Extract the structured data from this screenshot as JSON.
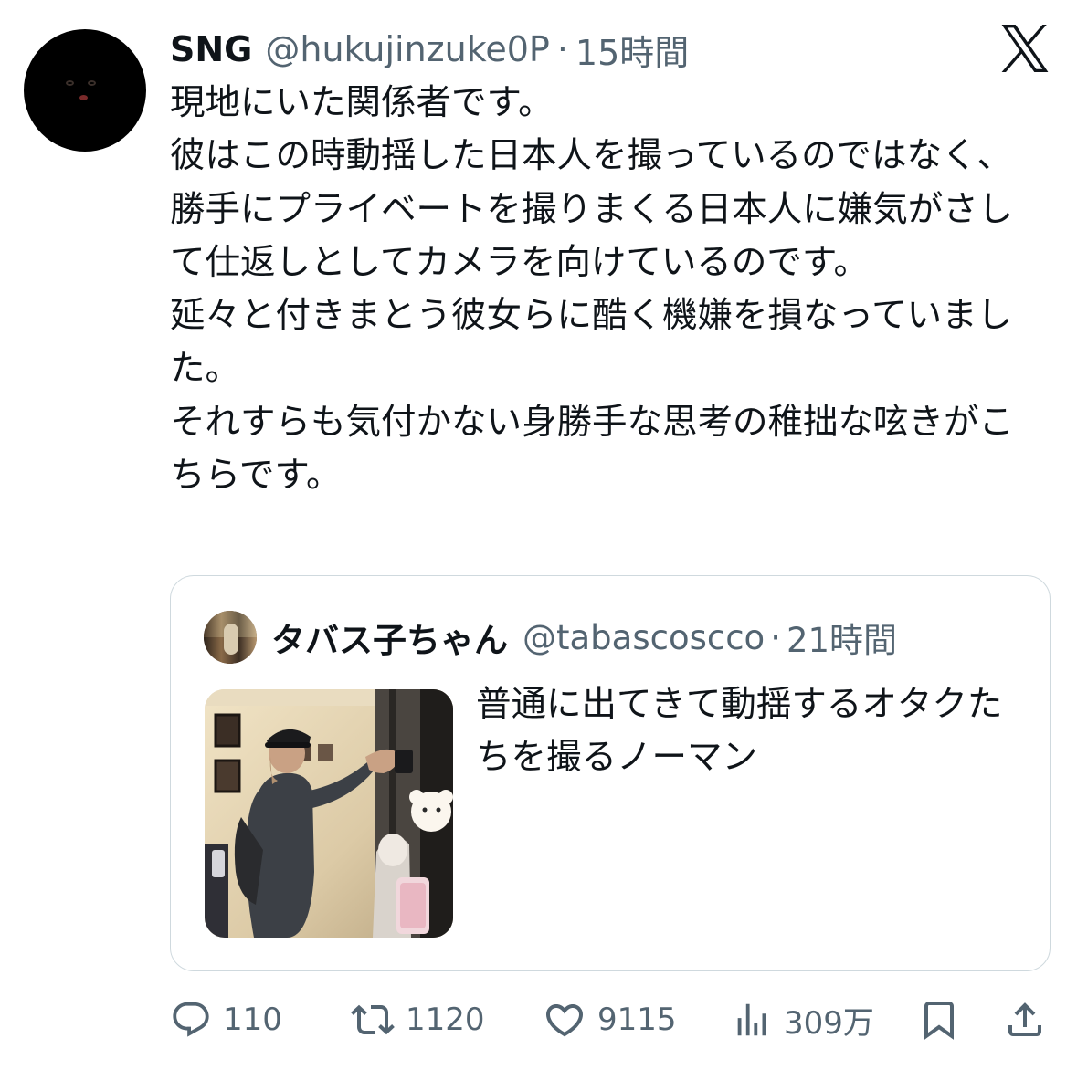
{
  "author": {
    "display_name": "SNG",
    "handle": "@hukujinzuke0P",
    "separator": "·",
    "time": "15時間"
  },
  "tweet": {
    "text": "現地にいた関係者です。\n彼はこの時動揺した日本人を撮っているのではなく、勝手にプライベートを撮りまくる日本人に嫌気がさして仕返しとしてカメラを向けているのです。\n延々と付きまとう彼女らに酷く機嫌を損なっていました。\nそれすらも気付かない身勝手な思考の稚拙な呟きがこちらです。"
  },
  "quote": {
    "display_name": "タバス子ちゃん",
    "handle": "@tabascoscco",
    "separator": "·",
    "time": "21時間",
    "text": "普通に出てきて動揺するオタクたちを撮るノーマン"
  },
  "actions": {
    "replies": "110",
    "retweets": "1120",
    "likes": "9115",
    "views": "309万"
  },
  "icons": {
    "brand": "x-logo-icon",
    "reply": "reply-icon",
    "retweet": "retweet-icon",
    "like": "heart-icon",
    "views": "views-chart-icon",
    "bookmark": "bookmark-icon",
    "share": "share-icon"
  },
  "colors": {
    "text_primary": "#0f1419",
    "text_secondary": "#536471",
    "border": "#cfd9de"
  }
}
